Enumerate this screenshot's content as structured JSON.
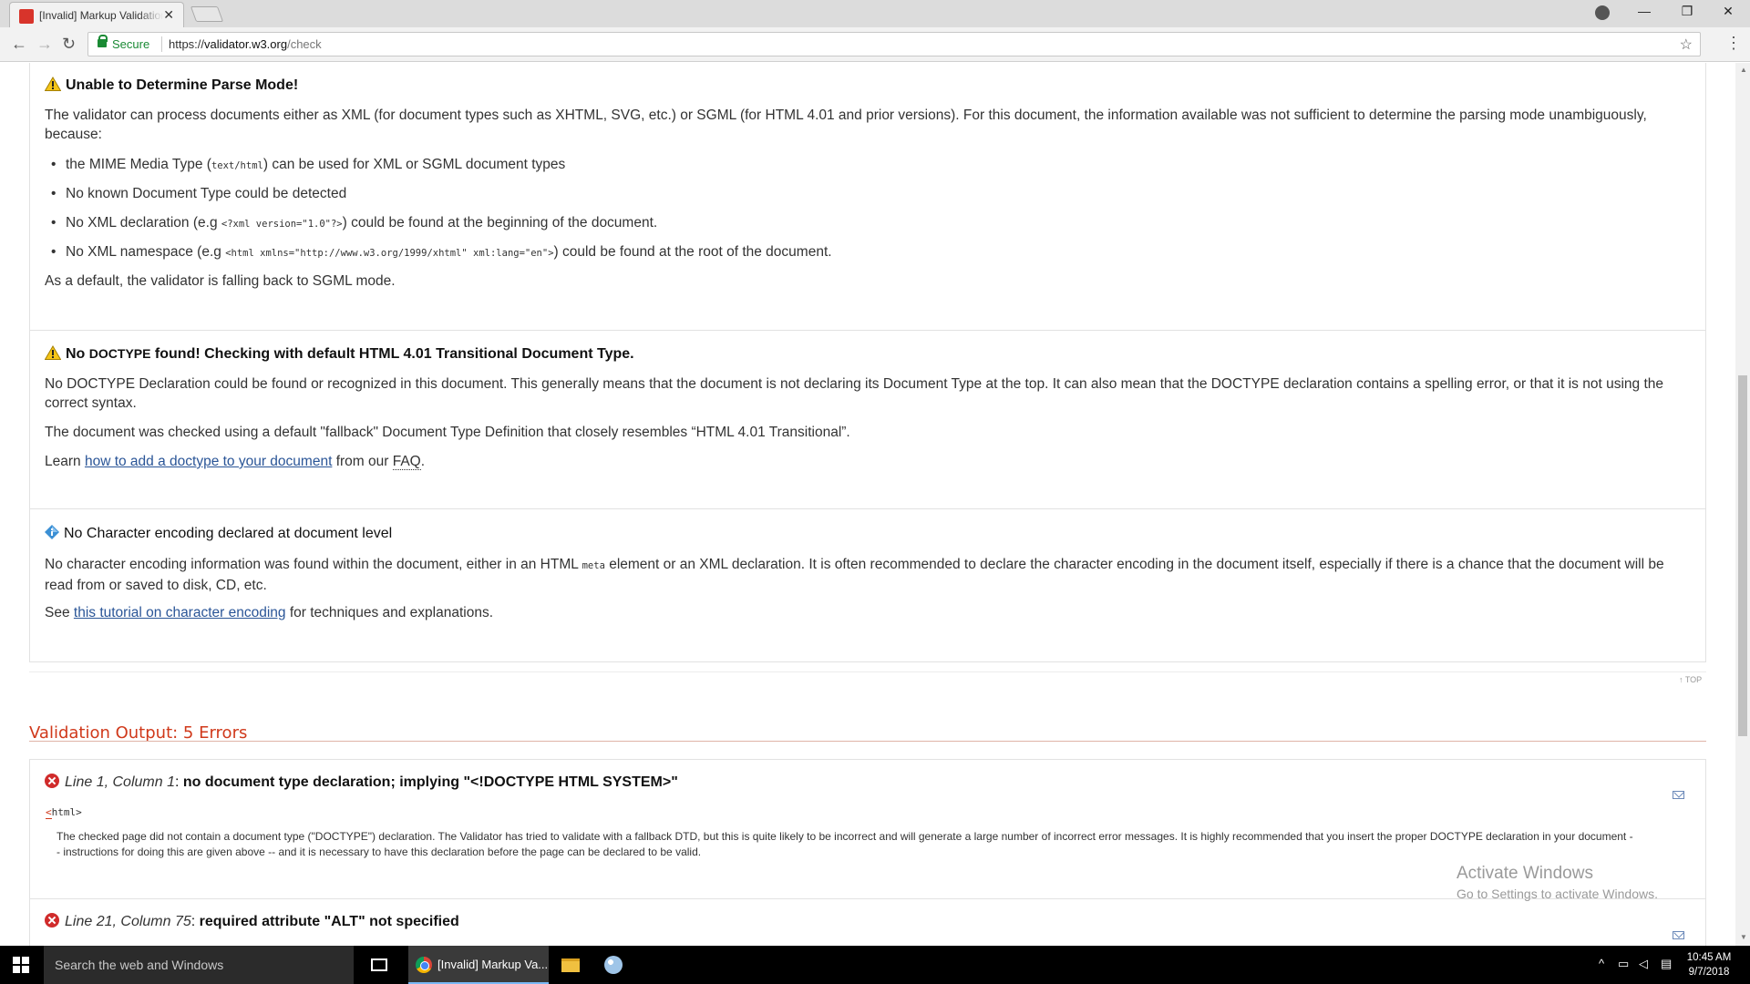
{
  "browser": {
    "tab_title": "[Invalid] Markup Validation Service",
    "tab_close": "✕",
    "secure_label": "Secure",
    "url_scheme": "https://",
    "url_host": "validator.w3.org",
    "url_path": "/check",
    "window_min": "—",
    "window_restore": "❐",
    "window_close": "✕"
  },
  "parse_mode": {
    "title": "Unable to Determine Parse Mode!",
    "intro": "The validator can process documents either as XML (for document types such as XHTML, SVG, etc.) or SGML (for HTML 4.01 and prior versions). For this document, the information available was not sufficient to determine the parsing mode unambiguously, because:",
    "bullets": [
      {
        "pre": "the MIME Media Type (",
        "code": "text/html",
        "post": ") can be used for XML or SGML document types"
      },
      {
        "pre": "No known Document Type could be detected",
        "code": "",
        "post": ""
      },
      {
        "pre": "No XML declaration (e.g ",
        "code": "<?xml version=\"1.0\"?>",
        "post": ") could be found at the beginning of the document."
      },
      {
        "pre": "No XML namespace (e.g ",
        "code": "<html xmlns=\"http://www.w3.org/1999/xhtml\" xml:lang=\"en\">",
        "post": ") could be found at the root of the document."
      }
    ],
    "fallback": "As a default, the validator is falling back to SGML mode."
  },
  "doctype": {
    "title_pre": "No",
    "title_smallcaps": "DOCTYPE",
    "title_post": "found! Checking with default HTML 4.01 Transitional Document Type.",
    "para1": "No DOCTYPE Declaration could be found or recognized in this document. This generally means that the document is not declaring its Document Type at the top. It can also mean that the DOCTYPE declaration contains a spelling error, or that it is not using the correct syntax.",
    "para2": "The document was checked using a default \"fallback\" Document Type Definition that closely resembles “HTML 4.01 Transitional”.",
    "learn_pre": "Learn ",
    "learn_link": "how to add a doctype to your document",
    "learn_mid": " from our ",
    "learn_faq": "FAQ",
    "learn_post": "."
  },
  "charset": {
    "title": "No Character encoding declared at document level",
    "para_pre": "No character encoding information was found within the document, either in an HTML ",
    "para_code": "meta",
    "para_post": " element or an XML declaration. It is often recommended to declare the character encoding in the document itself, especially if there is a chance that the document will be read from or saved to disk, CD, etc.",
    "see_pre": "See ",
    "see_link": "this tutorial on character encoding",
    "see_post": " for techniques and explanations."
  },
  "top_link": "↑ TOP",
  "validation": {
    "heading": "Validation Output: 5 Errors",
    "errors": [
      {
        "location": "Line 1, Column 1",
        "message": "no document type declaration; implying \"<!DOCTYPE HTML SYSTEM>\"",
        "source_hl": "<",
        "source_rest": "html>",
        "description": "The checked page did not contain a document type (\"DOCTYPE\") declaration. The Validator has tried to validate with a fallback DTD, but this is quite likely to be incorrect and will generate a large number of incorrect error messages. It is highly recommended that you insert the proper DOCTYPE declaration in your document -- instructions for doing this are given above -- and it is necessary to have this declaration before the page can be declared to be valid."
      },
      {
        "location": "Line 21, Column 75",
        "message": "required attribute \"ALT\" not specified"
      }
    ]
  },
  "watermark": {
    "line1": "Activate Windows",
    "line2": "Go to Settings to activate Windows."
  },
  "taskbar": {
    "search_placeholder": "Search the web and Windows",
    "app_label": "[Invalid] Markup Va...",
    "time": "10:45 AM",
    "date": "9/7/2018"
  }
}
